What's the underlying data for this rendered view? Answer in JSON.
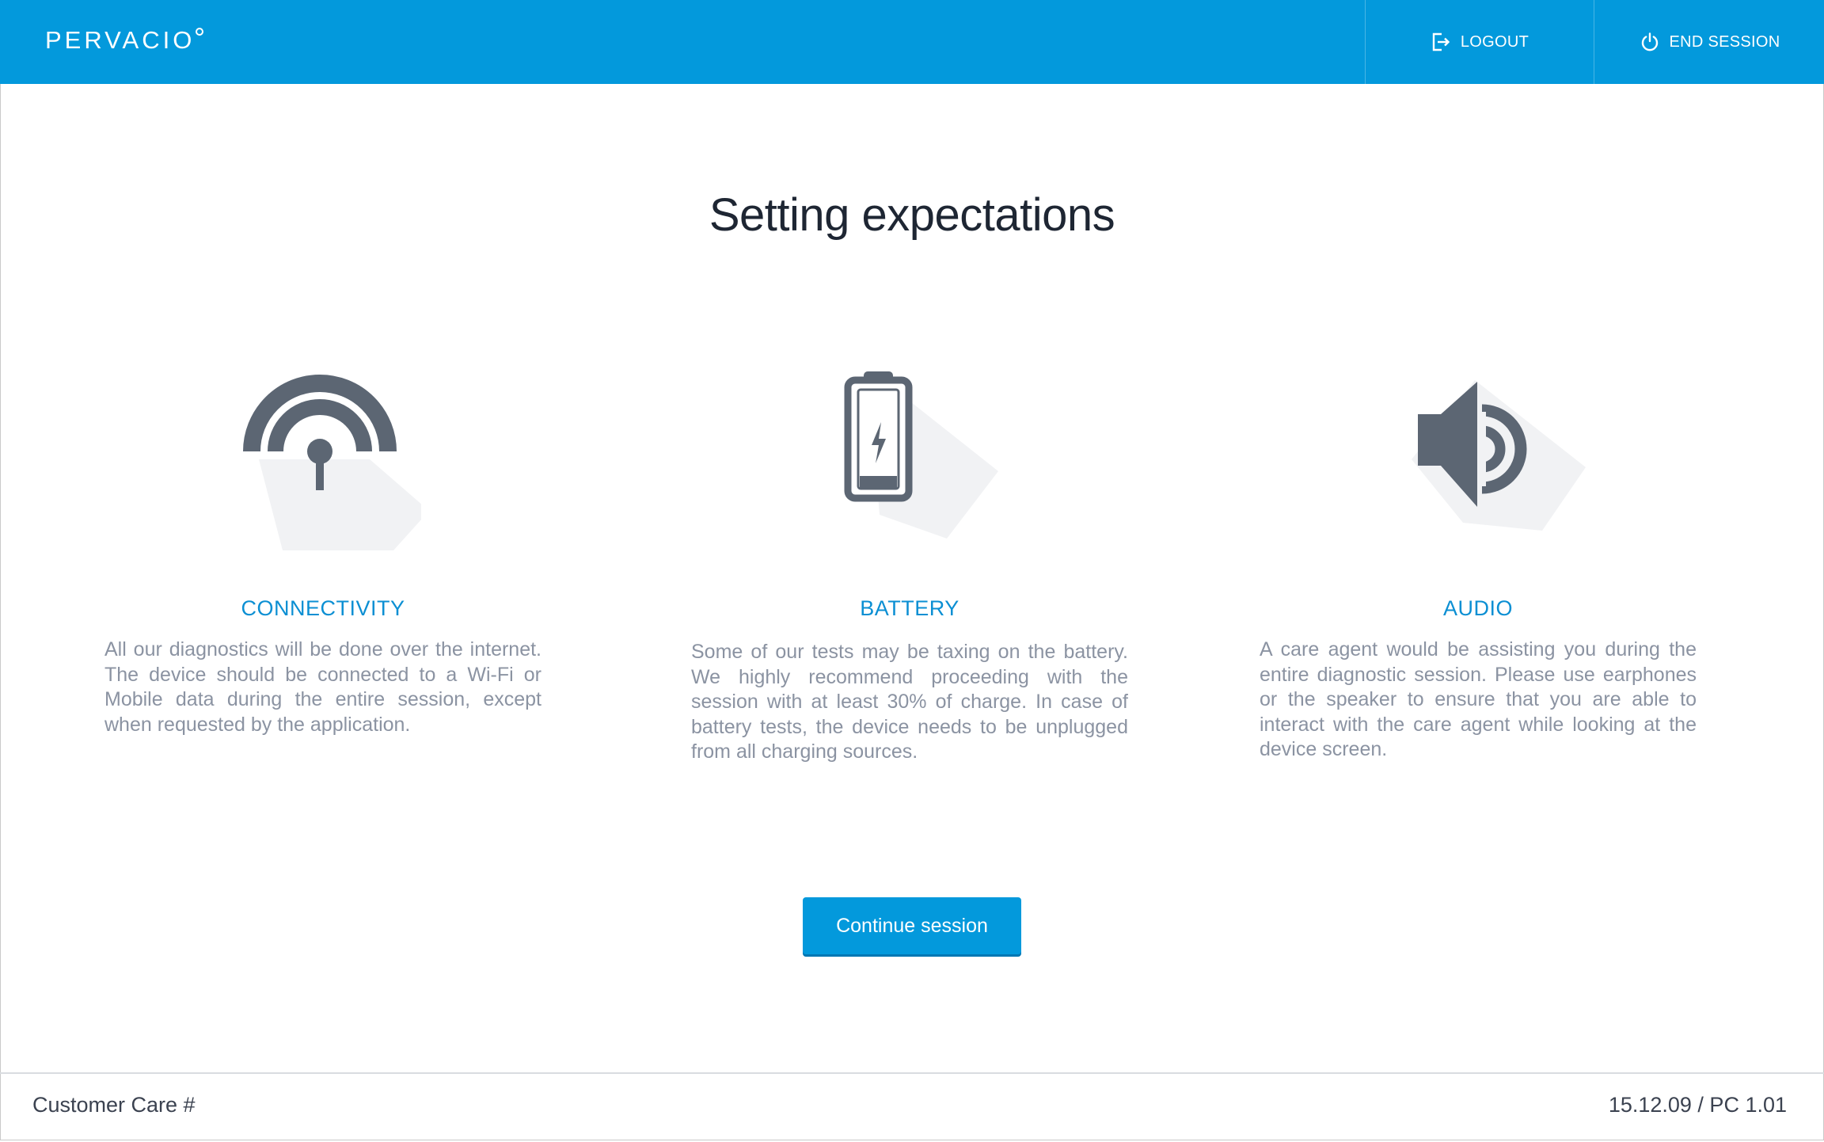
{
  "header": {
    "logo": "PERVACIO",
    "logout_label": "LOGOUT",
    "end_session_label": "END SESSION"
  },
  "page": {
    "title": "Setting expectations"
  },
  "sections": [
    {
      "icon": "wifi-icon",
      "title": "CONNECTIVITY",
      "text": "All our diagnostics will be done over the internet. The device should be connected to a Wi-Fi or Mobile data during the entire session, except when requested by the application."
    },
    {
      "icon": "battery-icon",
      "title": "BATTERY",
      "text": "Some of our tests may be taxing on the battery. We highly recommend proceeding with the session with at least 30% of charge. In case of battery tests, the device needs to be unplugged from all charging sources."
    },
    {
      "icon": "speaker-icon",
      "title": "AUDIO",
      "text": "A care agent would be assisting you during the entire diagnostic session. Please use earphones or the speaker to ensure that you are able to interact with the care agent while looking at the device screen."
    }
  ],
  "actions": {
    "continue_label": "Continue session"
  },
  "footer": {
    "left": "Customer Care #",
    "right": "15.12.09 / PC 1.01"
  },
  "colors": {
    "brand": "#0399dc",
    "icon": "#5c6673",
    "section_title": "#0b8fd3"
  }
}
